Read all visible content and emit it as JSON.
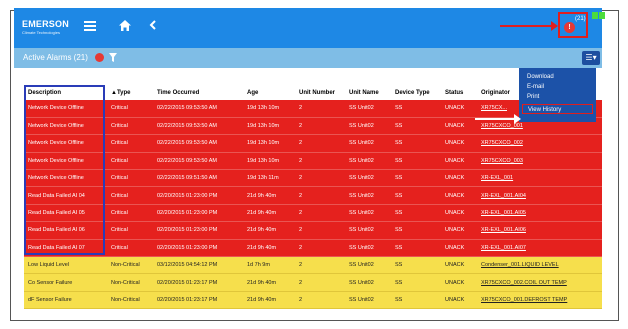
{
  "header": {
    "brand": "EMERSON",
    "tagline": "Climate Technologies",
    "alert_count": "(21)",
    "alert_glyph": "!",
    "accent_color": "#1e88e5"
  },
  "subbar": {
    "title": "Active Alarms (21)",
    "menu_glyph": "☰▾"
  },
  "dropdown": {
    "items": [
      "Download",
      "E-mail",
      "Print",
      "View History"
    ]
  },
  "table": {
    "columns": [
      "Description",
      "▲Type",
      "Time Occurred",
      "Age",
      "Unit Number",
      "Unit Name",
      "Device Type",
      "Status",
      "Originator"
    ],
    "rows": [
      [
        "Network Device Offline",
        "Critical",
        "02/22/2015 09:53:50 AM",
        "19d 13h 10m",
        "2",
        "SS Unit02",
        "SS",
        "UNACK",
        "XR75CX..."
      ],
      [
        "Network Device Offline",
        "Critical",
        "02/22/2015 09:53:50 AM",
        "19d 13h 10m",
        "2",
        "SS Unit02",
        "SS",
        "UNACK",
        "XR75CXCO_001"
      ],
      [
        "Network Device Offline",
        "Critical",
        "02/22/2015 09:53:50 AM",
        "19d 13h 10m",
        "2",
        "SS Unit02",
        "SS",
        "UNACK",
        "XR75CXCO_002"
      ],
      [
        "Network Device Offline",
        "Critical",
        "02/22/2015 09:53:50 AM",
        "19d 13h 10m",
        "2",
        "SS Unit02",
        "SS",
        "UNACK",
        "XR75CXCO_003"
      ],
      [
        "Network Device Offline",
        "Critical",
        "02/22/2015 09:51:50 AM",
        "19d 13h 11m",
        "2",
        "SS Unit02",
        "SS",
        "UNACK",
        "XR-EXL_001"
      ],
      [
        "Read Data Failed AI 04",
        "Critical",
        "02/20/2015 01:23:00 PM",
        "21d 9h 40m",
        "2",
        "SS Unit02",
        "SS",
        "UNACK",
        "XR-EXL_001.AI04"
      ],
      [
        "Read Data Failed AI 05",
        "Critical",
        "02/20/2015 01:23:00 PM",
        "21d 9h 40m",
        "2",
        "SS Unit02",
        "SS",
        "UNACK",
        "XR-EXL_001.AI05"
      ],
      [
        "Read Data Failed AI 06",
        "Critical",
        "02/20/2015 01:23:00 PM",
        "21d 9h 40m",
        "2",
        "SS Unit02",
        "SS",
        "UNACK",
        "XR-EXL_001.AI06"
      ],
      [
        "Read Data Failed AI 07",
        "Critical",
        "02/20/2015 01:23:00 PM",
        "21d 9h 40m",
        "2",
        "SS Unit02",
        "SS",
        "UNACK",
        "XR-EXL_001.AI07"
      ],
      [
        "Low Liquid Level",
        "Non-Critical",
        "03/12/2015 04:54:12 PM",
        "1d 7h 9m",
        "2",
        "SS Unit02",
        "SS",
        "UNACK",
        "Condenser_001.LIQUID LEVEL"
      ],
      [
        "Co Sensor Failure",
        "Non-Critical",
        "02/20/2015 01:23:17 PM",
        "21d 9h 40m",
        "2",
        "SS Unit02",
        "SS",
        "UNACK",
        "XR75CXCO_002.COIL OUT TEMP"
      ],
      [
        "dF Sensor Failure",
        "Non-Critical",
        "02/20/2015 01:23:17 PM",
        "21d 9h 40m",
        "2",
        "SS Unit02",
        "SS",
        "UNACK",
        "XR75CXCO_001.DEFROST TEMP"
      ]
    ]
  },
  "colors": {
    "critical_row": "#e5211e",
    "noncritical_row": "#f6df4c",
    "highlight_box": "#2a3cb8",
    "callout": "#e01e1e"
  }
}
